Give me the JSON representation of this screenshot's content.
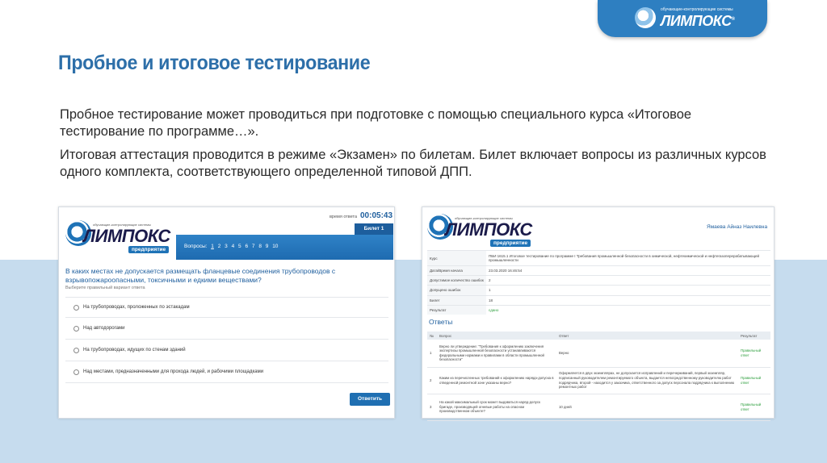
{
  "brand": {
    "tagline": "обучающие-контролирующие системы",
    "name": "ЛИМПОКС",
    "reg": "®"
  },
  "slide": {
    "title": "Пробное и итоговое тестирование",
    "p1": "Пробное тестирование может проводиться при подготовке с помощью специального курса «Итоговое тестирование по программе…».",
    "p2": "Итоговая аттестация проводится в режиме «Экзамен» по билетам. Билет включает вопросы из различных курсов одного комплекта, соответствующего определенной типовой ДПП."
  },
  "exam": {
    "logo_tagline": "обучающие-контролирующие системы",
    "logo_word": "ЛИМПОКС",
    "logo_sub": "предприятие",
    "timer_label": "время ответа",
    "timer": "00:05:43",
    "ticket": "Билет 1",
    "questions_label": "Вопросы:",
    "question_numbers": [
      "1",
      "2",
      "3",
      "4",
      "5",
      "6",
      "7",
      "8",
      "9",
      "10"
    ],
    "question": "В каких местах не допускается размещать фланцевые соединения трубопроводов с взрывопожароопасными, токсичными и едкими веществами?",
    "hint": "Выберите правильный вариант ответа",
    "options": [
      "На трубопроводах, проложенных по эстакадам",
      "Над автодорогами",
      "На трубопроводах, идущих по стенам зданий",
      "Над местами, предназначенными для прохода людей, и рабочими площадками"
    ],
    "answer_button": "Ответить"
  },
  "result": {
    "logo_tagline": "обучающие-контролирующие системы",
    "logo_word": "ЛИМПОКС",
    "logo_sub": "предприятие",
    "user": "Ямаева Айназ Наилевна",
    "info": [
      {
        "key": "Курс",
        "value": "ПБИ 1615.1 Итоговое тестирование по программе I Требования промышленной безопасности в химической, нефтехимической и нефтегазоперерабатывающей промышленности"
      },
      {
        "key": "Дата/Время начала",
        "value": "23.03.2020 16:46:54"
      },
      {
        "key": "Допустимое количество ошибок",
        "value": "2"
      },
      {
        "key": "Допущено ошибок",
        "value": "1"
      },
      {
        "key": "Билет",
        "value": "18"
      },
      {
        "key": "Результат",
        "value": "сдано"
      }
    ],
    "answers_title": "Ответы",
    "columns": [
      "№",
      "Вопрос",
      "Ответ",
      "Результат"
    ],
    "rows": [
      {
        "n": "1",
        "q": "Верно ли утверждение: \"Требования к оформлению заключения экспертизы промышленной безопасности устанавливаются федеральными нормами и правилами в области промышленной безопасности\"",
        "a": "Верно",
        "r": "Правильный ответ"
      },
      {
        "n": "2",
        "q": "Каким из перечисленных требований к оформлению наряда-допуска в отведенной ремонтной зоне указаны верно?",
        "a": "Оформляется в двух экземплярах, не допускается исправлений и перечеркиваний, первый экземпляр, подписанный руководителем ремонтируемого объекта, выдается непосредственному руководителю работ подрядчика, второй - находится у заказчика, ответственного за допуск персонала подрядчика к выполнению ремонтных работ",
        "r": "Правильный ответ"
      },
      {
        "n": "3",
        "q": "На какой максимальный срок может выдаваться наряд-допуск бригаде, производящей огневые работы на опасном производственном объекте?",
        "a": "10 дней",
        "r": "Правильный ответ"
      }
    ]
  },
  "colors": {
    "brand_blue": "#2e7fc1",
    "title_blue": "#2d6fa9",
    "band": "#c6dcee",
    "success": "#2a9d3a"
  }
}
